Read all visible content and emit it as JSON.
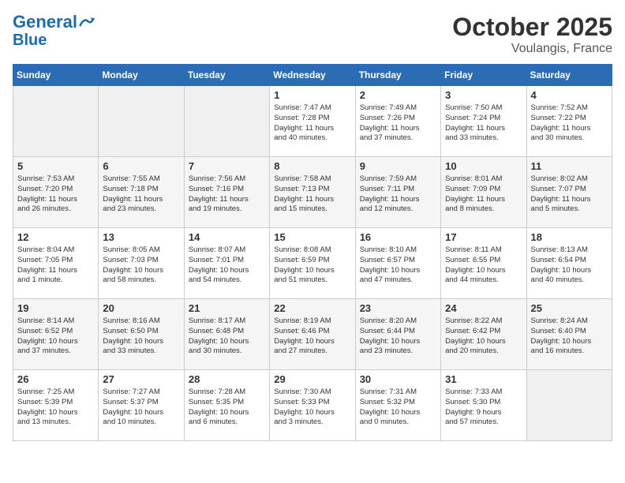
{
  "header": {
    "logo_line1": "General",
    "logo_line2": "Blue",
    "month": "October 2025",
    "location": "Voulangis, France"
  },
  "weekdays": [
    "Sunday",
    "Monday",
    "Tuesday",
    "Wednesday",
    "Thursday",
    "Friday",
    "Saturday"
  ],
  "weeks": [
    [
      {
        "day": "",
        "info": ""
      },
      {
        "day": "",
        "info": ""
      },
      {
        "day": "",
        "info": ""
      },
      {
        "day": "1",
        "info": "Sunrise: 7:47 AM\nSunset: 7:28 PM\nDaylight: 11 hours\nand 40 minutes."
      },
      {
        "day": "2",
        "info": "Sunrise: 7:49 AM\nSunset: 7:26 PM\nDaylight: 11 hours\nand 37 minutes."
      },
      {
        "day": "3",
        "info": "Sunrise: 7:50 AM\nSunset: 7:24 PM\nDaylight: 11 hours\nand 33 minutes."
      },
      {
        "day": "4",
        "info": "Sunrise: 7:52 AM\nSunset: 7:22 PM\nDaylight: 11 hours\nand 30 minutes."
      }
    ],
    [
      {
        "day": "5",
        "info": "Sunrise: 7:53 AM\nSunset: 7:20 PM\nDaylight: 11 hours\nand 26 minutes."
      },
      {
        "day": "6",
        "info": "Sunrise: 7:55 AM\nSunset: 7:18 PM\nDaylight: 11 hours\nand 23 minutes."
      },
      {
        "day": "7",
        "info": "Sunrise: 7:56 AM\nSunset: 7:16 PM\nDaylight: 11 hours\nand 19 minutes."
      },
      {
        "day": "8",
        "info": "Sunrise: 7:58 AM\nSunset: 7:13 PM\nDaylight: 11 hours\nand 15 minutes."
      },
      {
        "day": "9",
        "info": "Sunrise: 7:59 AM\nSunset: 7:11 PM\nDaylight: 11 hours\nand 12 minutes."
      },
      {
        "day": "10",
        "info": "Sunrise: 8:01 AM\nSunset: 7:09 PM\nDaylight: 11 hours\nand 8 minutes."
      },
      {
        "day": "11",
        "info": "Sunrise: 8:02 AM\nSunset: 7:07 PM\nDaylight: 11 hours\nand 5 minutes."
      }
    ],
    [
      {
        "day": "12",
        "info": "Sunrise: 8:04 AM\nSunset: 7:05 PM\nDaylight: 11 hours\nand 1 minute."
      },
      {
        "day": "13",
        "info": "Sunrise: 8:05 AM\nSunset: 7:03 PM\nDaylight: 10 hours\nand 58 minutes."
      },
      {
        "day": "14",
        "info": "Sunrise: 8:07 AM\nSunset: 7:01 PM\nDaylight: 10 hours\nand 54 minutes."
      },
      {
        "day": "15",
        "info": "Sunrise: 8:08 AM\nSunset: 6:59 PM\nDaylight: 10 hours\nand 51 minutes."
      },
      {
        "day": "16",
        "info": "Sunrise: 8:10 AM\nSunset: 6:57 PM\nDaylight: 10 hours\nand 47 minutes."
      },
      {
        "day": "17",
        "info": "Sunrise: 8:11 AM\nSunset: 6:55 PM\nDaylight: 10 hours\nand 44 minutes."
      },
      {
        "day": "18",
        "info": "Sunrise: 8:13 AM\nSunset: 6:54 PM\nDaylight: 10 hours\nand 40 minutes."
      }
    ],
    [
      {
        "day": "19",
        "info": "Sunrise: 8:14 AM\nSunset: 6:52 PM\nDaylight: 10 hours\nand 37 minutes."
      },
      {
        "day": "20",
        "info": "Sunrise: 8:16 AM\nSunset: 6:50 PM\nDaylight: 10 hours\nand 33 minutes."
      },
      {
        "day": "21",
        "info": "Sunrise: 8:17 AM\nSunset: 6:48 PM\nDaylight: 10 hours\nand 30 minutes."
      },
      {
        "day": "22",
        "info": "Sunrise: 8:19 AM\nSunset: 6:46 PM\nDaylight: 10 hours\nand 27 minutes."
      },
      {
        "day": "23",
        "info": "Sunrise: 8:20 AM\nSunset: 6:44 PM\nDaylight: 10 hours\nand 23 minutes."
      },
      {
        "day": "24",
        "info": "Sunrise: 8:22 AM\nSunset: 6:42 PM\nDaylight: 10 hours\nand 20 minutes."
      },
      {
        "day": "25",
        "info": "Sunrise: 8:24 AM\nSunset: 6:40 PM\nDaylight: 10 hours\nand 16 minutes."
      }
    ],
    [
      {
        "day": "26",
        "info": "Sunrise: 7:25 AM\nSunset: 5:39 PM\nDaylight: 10 hours\nand 13 minutes."
      },
      {
        "day": "27",
        "info": "Sunrise: 7:27 AM\nSunset: 5:37 PM\nDaylight: 10 hours\nand 10 minutes."
      },
      {
        "day": "28",
        "info": "Sunrise: 7:28 AM\nSunset: 5:35 PM\nDaylight: 10 hours\nand 6 minutes."
      },
      {
        "day": "29",
        "info": "Sunrise: 7:30 AM\nSunset: 5:33 PM\nDaylight: 10 hours\nand 3 minutes."
      },
      {
        "day": "30",
        "info": "Sunrise: 7:31 AM\nSunset: 5:32 PM\nDaylight: 10 hours\nand 0 minutes."
      },
      {
        "day": "31",
        "info": "Sunrise: 7:33 AM\nSunset: 5:30 PM\nDaylight: 9 hours\nand 57 minutes."
      },
      {
        "day": "",
        "info": ""
      }
    ]
  ]
}
